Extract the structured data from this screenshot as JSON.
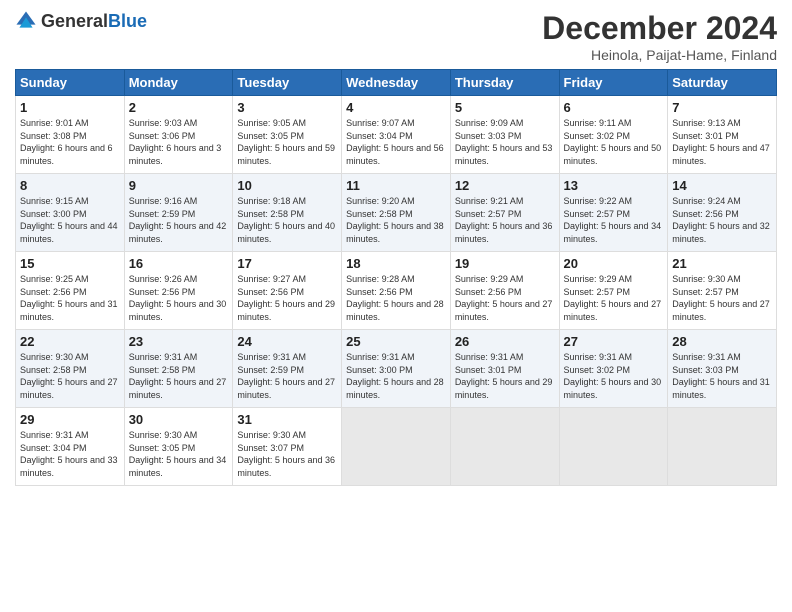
{
  "logo": {
    "general": "General",
    "blue": "Blue"
  },
  "header": {
    "month": "December 2024",
    "location": "Heinola, Paijat-Hame, Finland"
  },
  "columns": [
    "Sunday",
    "Monday",
    "Tuesday",
    "Wednesday",
    "Thursday",
    "Friday",
    "Saturday"
  ],
  "weeks": [
    [
      {
        "day": "1",
        "sunrise": "Sunrise: 9:01 AM",
        "sunset": "Sunset: 3:08 PM",
        "daylight": "Daylight: 6 hours and 6 minutes."
      },
      {
        "day": "2",
        "sunrise": "Sunrise: 9:03 AM",
        "sunset": "Sunset: 3:06 PM",
        "daylight": "Daylight: 6 hours and 3 minutes."
      },
      {
        "day": "3",
        "sunrise": "Sunrise: 9:05 AM",
        "sunset": "Sunset: 3:05 PM",
        "daylight": "Daylight: 5 hours and 59 minutes."
      },
      {
        "day": "4",
        "sunrise": "Sunrise: 9:07 AM",
        "sunset": "Sunset: 3:04 PM",
        "daylight": "Daylight: 5 hours and 56 minutes."
      },
      {
        "day": "5",
        "sunrise": "Sunrise: 9:09 AM",
        "sunset": "Sunset: 3:03 PM",
        "daylight": "Daylight: 5 hours and 53 minutes."
      },
      {
        "day": "6",
        "sunrise": "Sunrise: 9:11 AM",
        "sunset": "Sunset: 3:02 PM",
        "daylight": "Daylight: 5 hours and 50 minutes."
      },
      {
        "day": "7",
        "sunrise": "Sunrise: 9:13 AM",
        "sunset": "Sunset: 3:01 PM",
        "daylight": "Daylight: 5 hours and 47 minutes."
      }
    ],
    [
      {
        "day": "8",
        "sunrise": "Sunrise: 9:15 AM",
        "sunset": "Sunset: 3:00 PM",
        "daylight": "Daylight: 5 hours and 44 minutes."
      },
      {
        "day": "9",
        "sunrise": "Sunrise: 9:16 AM",
        "sunset": "Sunset: 2:59 PM",
        "daylight": "Daylight: 5 hours and 42 minutes."
      },
      {
        "day": "10",
        "sunrise": "Sunrise: 9:18 AM",
        "sunset": "Sunset: 2:58 PM",
        "daylight": "Daylight: 5 hours and 40 minutes."
      },
      {
        "day": "11",
        "sunrise": "Sunrise: 9:20 AM",
        "sunset": "Sunset: 2:58 PM",
        "daylight": "Daylight: 5 hours and 38 minutes."
      },
      {
        "day": "12",
        "sunrise": "Sunrise: 9:21 AM",
        "sunset": "Sunset: 2:57 PM",
        "daylight": "Daylight: 5 hours and 36 minutes."
      },
      {
        "day": "13",
        "sunrise": "Sunrise: 9:22 AM",
        "sunset": "Sunset: 2:57 PM",
        "daylight": "Daylight: 5 hours and 34 minutes."
      },
      {
        "day": "14",
        "sunrise": "Sunrise: 9:24 AM",
        "sunset": "Sunset: 2:56 PM",
        "daylight": "Daylight: 5 hours and 32 minutes."
      }
    ],
    [
      {
        "day": "15",
        "sunrise": "Sunrise: 9:25 AM",
        "sunset": "Sunset: 2:56 PM",
        "daylight": "Daylight: 5 hours and 31 minutes."
      },
      {
        "day": "16",
        "sunrise": "Sunrise: 9:26 AM",
        "sunset": "Sunset: 2:56 PM",
        "daylight": "Daylight: 5 hours and 30 minutes."
      },
      {
        "day": "17",
        "sunrise": "Sunrise: 9:27 AM",
        "sunset": "Sunset: 2:56 PM",
        "daylight": "Daylight: 5 hours and 29 minutes."
      },
      {
        "day": "18",
        "sunrise": "Sunrise: 9:28 AM",
        "sunset": "Sunset: 2:56 PM",
        "daylight": "Daylight: 5 hours and 28 minutes."
      },
      {
        "day": "19",
        "sunrise": "Sunrise: 9:29 AM",
        "sunset": "Sunset: 2:56 PM",
        "daylight": "Daylight: 5 hours and 27 minutes."
      },
      {
        "day": "20",
        "sunrise": "Sunrise: 9:29 AM",
        "sunset": "Sunset: 2:57 PM",
        "daylight": "Daylight: 5 hours and 27 minutes."
      },
      {
        "day": "21",
        "sunrise": "Sunrise: 9:30 AM",
        "sunset": "Sunset: 2:57 PM",
        "daylight": "Daylight: 5 hours and 27 minutes."
      }
    ],
    [
      {
        "day": "22",
        "sunrise": "Sunrise: 9:30 AM",
        "sunset": "Sunset: 2:58 PM",
        "daylight": "Daylight: 5 hours and 27 minutes."
      },
      {
        "day": "23",
        "sunrise": "Sunrise: 9:31 AM",
        "sunset": "Sunset: 2:58 PM",
        "daylight": "Daylight: 5 hours and 27 minutes."
      },
      {
        "day": "24",
        "sunrise": "Sunrise: 9:31 AM",
        "sunset": "Sunset: 2:59 PM",
        "daylight": "Daylight: 5 hours and 27 minutes."
      },
      {
        "day": "25",
        "sunrise": "Sunrise: 9:31 AM",
        "sunset": "Sunset: 3:00 PM",
        "daylight": "Daylight: 5 hours and 28 minutes."
      },
      {
        "day": "26",
        "sunrise": "Sunrise: 9:31 AM",
        "sunset": "Sunset: 3:01 PM",
        "daylight": "Daylight: 5 hours and 29 minutes."
      },
      {
        "day": "27",
        "sunrise": "Sunrise: 9:31 AM",
        "sunset": "Sunset: 3:02 PM",
        "daylight": "Daylight: 5 hours and 30 minutes."
      },
      {
        "day": "28",
        "sunrise": "Sunrise: 9:31 AM",
        "sunset": "Sunset: 3:03 PM",
        "daylight": "Daylight: 5 hours and 31 minutes."
      }
    ],
    [
      {
        "day": "29",
        "sunrise": "Sunrise: 9:31 AM",
        "sunset": "Sunset: 3:04 PM",
        "daylight": "Daylight: 5 hours and 33 minutes."
      },
      {
        "day": "30",
        "sunrise": "Sunrise: 9:30 AM",
        "sunset": "Sunset: 3:05 PM",
        "daylight": "Daylight: 5 hours and 34 minutes."
      },
      {
        "day": "31",
        "sunrise": "Sunrise: 9:30 AM",
        "sunset": "Sunset: 3:07 PM",
        "daylight": "Daylight: 5 hours and 36 minutes."
      },
      null,
      null,
      null,
      null
    ]
  ]
}
